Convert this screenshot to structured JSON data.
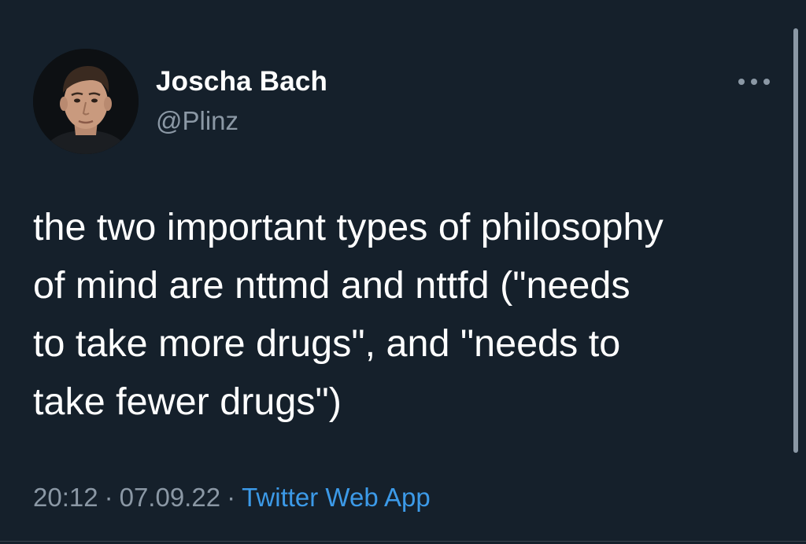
{
  "author": {
    "name": "Joscha Bach",
    "handle": "@Plinz"
  },
  "tweet": {
    "lines": [
      "the two important types of philosophy",
      "of mind are nttmd and nttfd (\"needs",
      "to take more drugs\", and \"needs to",
      "take fewer drugs\")"
    ]
  },
  "meta": {
    "time": "20:12",
    "separator": "·",
    "date": "07.09.22",
    "source": "Twitter Web App"
  },
  "icons": {
    "more": "more-horizontal-icon",
    "avatar": "profile-photo"
  },
  "colors": {
    "background": "#15202b",
    "text": "#ffffff",
    "secondary": "#8b98a5",
    "link": "#3c9ae8"
  }
}
